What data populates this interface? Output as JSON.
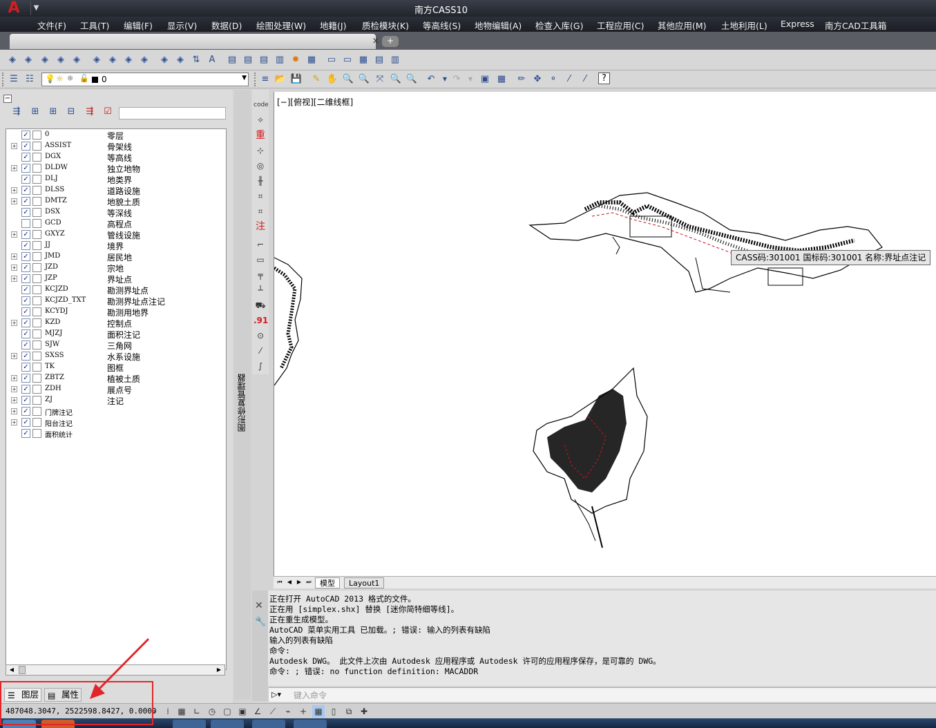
{
  "window": {
    "title": "南方CASS10"
  },
  "menu": [
    "文件(F)",
    "工具(T)",
    "编辑(F)",
    "显示(V)",
    "数据(D)",
    "绘图处理(W)",
    "地籍(J)",
    "质检模块(K)",
    "等高线(S)",
    "地物编辑(A)",
    "检查入库(G)",
    "工程应用(C)",
    "其他应用(M)",
    "土地利用(L)",
    "Express",
    "南方CAD工具箱"
  ],
  "layer_combo": {
    "value": "0"
  },
  "layers": [
    {
      "name": "0",
      "desc": "零层",
      "checked": true,
      "expandable": false
    },
    {
      "name": "ASSIST",
      "desc": "骨架线",
      "checked": true,
      "expandable": true
    },
    {
      "name": "DGX",
      "desc": "等高线",
      "checked": true,
      "expandable": false
    },
    {
      "name": "DLDW",
      "desc": "独立地物",
      "checked": true,
      "expandable": true
    },
    {
      "name": "DLJ",
      "desc": "地类界",
      "checked": true,
      "expandable": false
    },
    {
      "name": "DLSS",
      "desc": "道路设施",
      "checked": true,
      "expandable": true
    },
    {
      "name": "DMTZ",
      "desc": "地貌土质",
      "checked": true,
      "expandable": true
    },
    {
      "name": "DSX",
      "desc": "等深线",
      "checked": true,
      "expandable": false
    },
    {
      "name": "GCD",
      "desc": "高程点",
      "checked": false,
      "expandable": false
    },
    {
      "name": "GXYZ",
      "desc": "管线设施",
      "checked": true,
      "expandable": true
    },
    {
      "name": "JJ",
      "desc": "境界",
      "checked": true,
      "expandable": false
    },
    {
      "name": "JMD",
      "desc": "居民地",
      "checked": true,
      "expandable": true
    },
    {
      "name": "JZD",
      "desc": "宗地",
      "checked": true,
      "expandable": true
    },
    {
      "name": "JZP",
      "desc": "界址点",
      "checked": true,
      "expandable": true
    },
    {
      "name": "KCJZD",
      "desc": "勘测界址点",
      "checked": true,
      "expandable": false
    },
    {
      "name": "KCJZD_TXT",
      "desc": "勘测界址点注记",
      "checked": true,
      "expandable": false
    },
    {
      "name": "KCYDJ",
      "desc": "勘测用地界",
      "checked": true,
      "expandable": false
    },
    {
      "name": "KZD",
      "desc": "控制点",
      "checked": true,
      "expandable": true
    },
    {
      "name": "MJZJ",
      "desc": "面积注记",
      "checked": true,
      "expandable": false
    },
    {
      "name": "SJW",
      "desc": "三角网",
      "checked": true,
      "expandable": false
    },
    {
      "name": "SXSS",
      "desc": "水系设施",
      "checked": true,
      "expandable": true
    },
    {
      "name": "TK",
      "desc": "图框",
      "checked": true,
      "expandable": false
    },
    {
      "name": "ZBTZ",
      "desc": "植被土质",
      "checked": true,
      "expandable": true
    },
    {
      "name": "ZDH",
      "desc": "展点号",
      "checked": true,
      "expandable": true
    },
    {
      "name": "ZJ",
      "desc": "注记",
      "checked": true,
      "expandable": true
    },
    {
      "name": "门牌注记",
      "desc": "",
      "checked": true,
      "expandable": true
    },
    {
      "name": "阳台注记",
      "desc": "",
      "checked": true,
      "expandable": true
    },
    {
      "name": "面积统计",
      "desc": "",
      "checked": true,
      "expandable": false
    }
  ],
  "panel_tabs": {
    "layers": "图层",
    "properties": "属性"
  },
  "side_strip_label": "图形修复管理器",
  "cass_bar": {
    "label_heavy": "重",
    "label_note": "注",
    "label_num": ".91"
  },
  "view_label": "[−][俯视][二维线框]",
  "tooltip": "CASS码:301001 国标码:301001 名称:界址点注记",
  "layout_tabs": {
    "model": "模型",
    "layout1": "Layout1"
  },
  "command_log": [
    "正在打开 AutoCAD 2013 格式的文件。",
    "正在用 [simplex.shx] 替换 [迷你简特细等线]。",
    "正在重生成模型。",
    "AutoCAD 菜单实用工具 已加载。; 错误: 输入的列表有缺陷",
    "输入的列表有缺陷",
    "命令:",
    "Autodesk DWG。  此文件上次由 Autodesk 应用程序或 Autodesk 许可的应用程序保存，是可靠的 DWG。",
    "命令: ; 错误: no function definition: MACADDR"
  ],
  "command_input": {
    "placeholder": "键入命令"
  },
  "status": {
    "coords": "487048.3047, 2522598.8427, 0.0000"
  },
  "colors": {
    "highlight": "#e0262a",
    "map_line": "#000000",
    "map_red": "#c0141e"
  },
  "icons": {
    "checked": "✓"
  }
}
